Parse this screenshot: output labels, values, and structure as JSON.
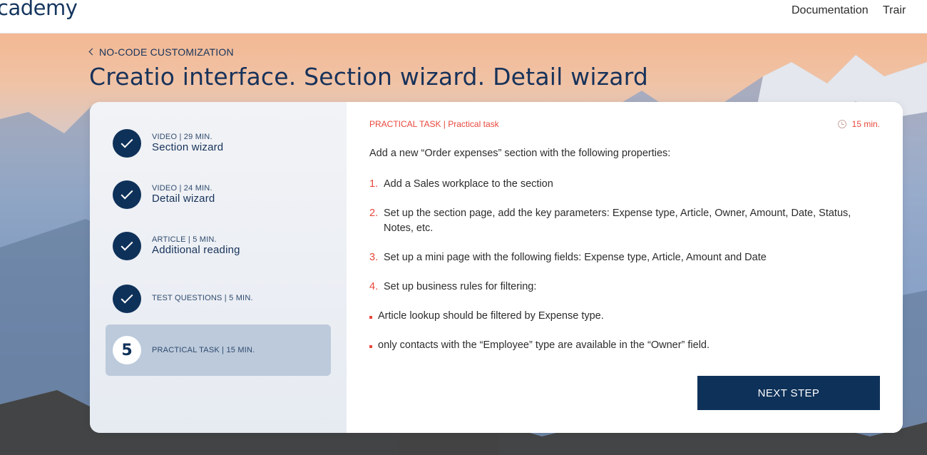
{
  "header": {
    "logo_text": "cademy",
    "nav": [
      "Documentation",
      "Trair"
    ]
  },
  "breadcrumb": {
    "label": "NO-CODE CUSTOMIZATION"
  },
  "page_title": "Creatio interface. Section wizard. Detail wizard",
  "steps": [
    {
      "meta": "VIDEO | 29 MIN.",
      "title": "Section wizard",
      "status": "done"
    },
    {
      "meta": "VIDEO | 24 MIN.",
      "title": "Detail wizard",
      "status": "done"
    },
    {
      "meta": "ARTICLE | 5 MIN.",
      "title": "Additional reading",
      "status": "done"
    },
    {
      "meta": "TEST QUESTIONS | 5 MIN.",
      "title": "",
      "status": "done"
    },
    {
      "meta": "PRACTICAL TASK | 15 MIN.",
      "title": "",
      "status": "active",
      "number": "5"
    }
  ],
  "task": {
    "label": "PRACTICAL TASK | Practical task",
    "duration": "15 min.",
    "intro": "Add a new “Order expenses” section with the following properties:",
    "items": [
      {
        "n": "1.",
        "text": "Add a Sales workplace to the section"
      },
      {
        "n": "2.",
        "text": "Set up the section page, add the key parameters: Expense type, Article, Owner, Amount, Date, Status, Notes, etc."
      },
      {
        "n": "3.",
        "text": "Set up a mini page with the following fields: Expense type, Article, Amount and Date"
      },
      {
        "n": "4.",
        "text": "Set up business rules for filtering:"
      }
    ],
    "bullets": [
      "Article lookup should be filtered by Expense type.",
      "only contacts with the “Employee” type are available in the “Owner” field."
    ],
    "next_label": "NEXT STEP"
  },
  "colors": {
    "brand_navy": "#0e3159",
    "accent_red": "#e8473c",
    "active_step_bg": "#bccadb"
  }
}
